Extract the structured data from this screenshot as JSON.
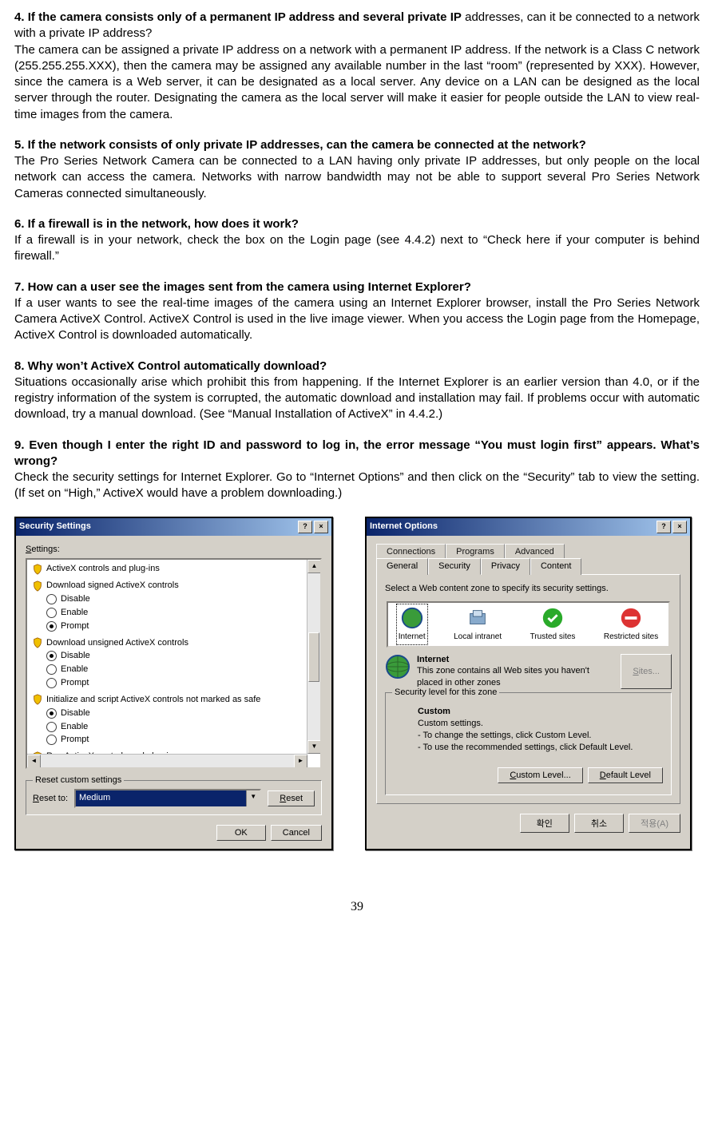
{
  "q4": {
    "title_bold": "4. If the camera consists only of a permanent IP address and several private IP",
    "title_rest": " addresses, can it be connected to a network with a private IP address?",
    "body": "The camera can be assigned a private IP address on a network with a permanent IP address. If the network is a Class C network (255.255.255.XXX), then the camera may be assigned any available number in the last “room” (represented by XXX). However, since the camera is a Web server, it can be designated as a local server. Any device on a LAN can be designed as the local server through the router. Designating the camera as the local server will make it easier for people outside the LAN to view real-time images from the camera."
  },
  "q5": {
    "title": "5. If the network consists of only private IP addresses, can the camera be connected at the network?",
    "body": "The Pro Series Network Camera can be connected to a LAN having only private IP addresses, but only people on the local network can access the camera. Networks with narrow bandwidth may not be able to support several Pro Series Network Cameras connected simultaneously."
  },
  "q6": {
    "title": "6. If a firewall is in the network, how does it work?",
    "body": "If a firewall is in your network, check the box on the Login page (see 4.4.2) next to “Check here if your computer is behind firewall.”"
  },
  "q7": {
    "title": "7. How can a user see the images sent from the camera using Internet Explorer?",
    "body": "If a user wants to see the real-time images of the camera using an Internet Explorer browser, install the Pro Series Network Camera ActiveX Control. ActiveX Control is used in the live image viewer. When you access the Login page from the Homepage, ActiveX Control is downloaded automatically."
  },
  "q8": {
    "title": "8. Why won’t ActiveX Control automatically download?",
    "body": "Situations occasionally arise which prohibit this from happening. If the Internet Explorer is an earlier version than 4.0, or if the registry information of the system is corrupted, the automatic download and installation may fail. If problems occur with automatic download, try a manual download. (See “Manual Installation of ActiveX” in 4.4.2.)"
  },
  "q9": {
    "title": "9. Even though I enter the right ID and password to log in, the error message “You must login first” appears. What’s wrong?",
    "body": "Check the security settings for Internet Explorer. Go to “Internet Options” and then click on the “Security” tab to view the setting. (If set on “High,” ActiveX would have a problem downloading.)"
  },
  "dlg1": {
    "title": "Security Settings",
    "settings_label": "Settings:",
    "groups": [
      {
        "label": "ActiveX controls and plug-ins",
        "opts": []
      },
      {
        "label": "Download signed ActiveX controls",
        "opts": [
          "Disable",
          "Enable",
          "Prompt"
        ],
        "sel": 2
      },
      {
        "label": "Download unsigned ActiveX controls",
        "opts": [
          "Disable",
          "Enable",
          "Prompt"
        ],
        "sel": 0
      },
      {
        "label": "Initialize and script ActiveX controls not marked as safe",
        "opts": [
          "Disable",
          "Enable",
          "Prompt"
        ],
        "sel": 0
      }
    ],
    "cut_row": "Run ActiveX controls and plug-ins",
    "reset_legend": "Reset custom settings",
    "reset_to": "Reset to:",
    "reset_val": "Medium",
    "reset_btn": "Reset",
    "ok": "OK",
    "cancel": "Cancel"
  },
  "dlg2": {
    "title": "Internet Options",
    "tabs_back": [
      "Connections",
      "Programs",
      "Advanced"
    ],
    "tabs_front": [
      "General",
      "Security",
      "Privacy",
      "Content"
    ],
    "active_tab": "Security",
    "prompt": "Select a Web content zone to specify its security settings.",
    "zones": [
      "Internet",
      "Local intranet",
      "Trusted sites",
      "Restricted sites"
    ],
    "zone_sel": 0,
    "zone_title": "Internet",
    "zone_desc": "This zone contains all Web sites you haven't placed in other zones",
    "sites": "Sites...",
    "sec_legend": "Security level for this zone",
    "custom": "Custom",
    "custom_l1": "Custom settings.",
    "custom_l2": "- To change the settings, click Custom Level.",
    "custom_l3": "- To use the recommended settings, click Default Level.",
    "custom_level": "Custom Level...",
    "default_level": "Default Level",
    "ok": "확인",
    "cancel": "취소",
    "apply": "적용(A)"
  },
  "page_number": "39"
}
